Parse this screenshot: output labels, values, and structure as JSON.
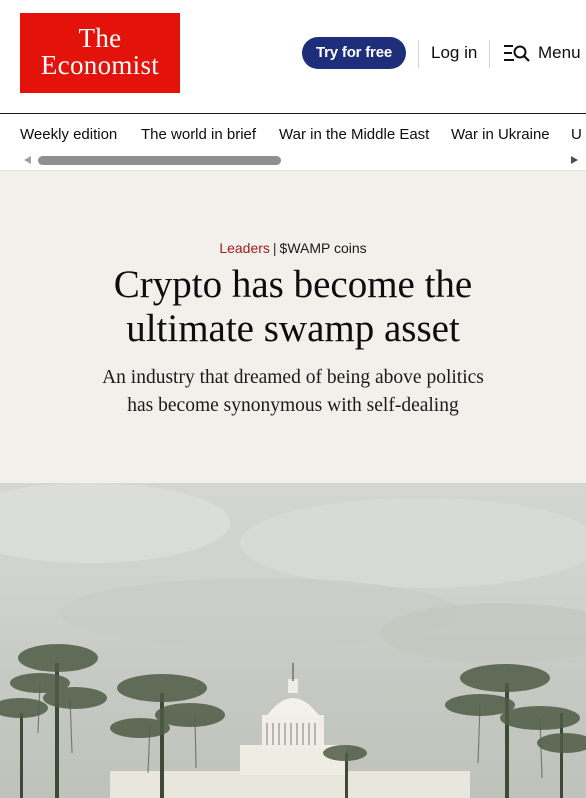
{
  "header": {
    "logo_line1": "The",
    "logo_line2": "Economist",
    "try_button": "Try for free",
    "login": "Log in",
    "menu": "Menu"
  },
  "nav": {
    "items": [
      "Weekly edition",
      "The world in brief",
      "War in the Middle East",
      "War in Ukraine",
      "U"
    ]
  },
  "article": {
    "section": "Leaders",
    "topic": "$WAMP coins",
    "headline_line1": "Crypto has become the",
    "headline_line2": "ultimate swamp asset",
    "standfirst_line1": "An industry that dreamed of being above politics",
    "standfirst_line2": "has become synonymous with self-dealing"
  },
  "colors": {
    "brand_red": "#e3120b",
    "button_navy": "#1f2e7a",
    "section_red": "#a01c1c",
    "article_bg": "#f2f0ea"
  },
  "icons": {
    "menu": "menu-search-icon",
    "scroll_left": "triangle-left-icon",
    "scroll_right": "triangle-right-icon"
  }
}
